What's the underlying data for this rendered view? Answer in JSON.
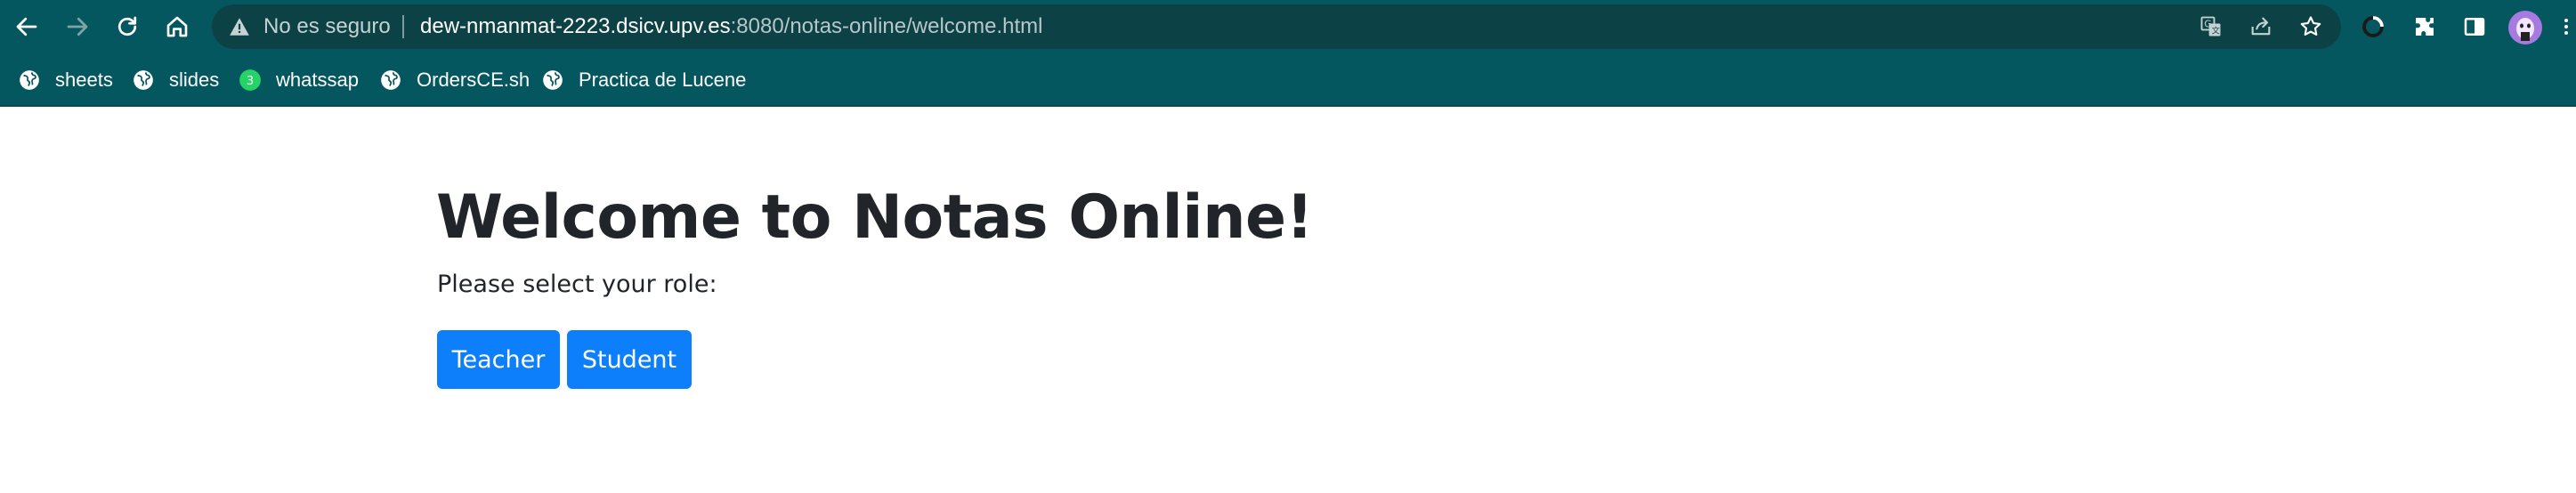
{
  "browser": {
    "security_status": "No es seguro",
    "url_host": "dew-nmanmat-2223.dsicv.upv.es",
    "url_rest": ":8080/notas-online/welcome.html",
    "bookmarks": [
      {
        "label": "sheets",
        "icon": "globe-icon"
      },
      {
        "label": "slides",
        "icon": "globe-icon"
      },
      {
        "label": "whatssap",
        "icon": "whatsapp-icon",
        "badge": "3"
      },
      {
        "label": "OrdersCE.sh",
        "icon": "globe-icon"
      },
      {
        "label": "Practica de Lucene",
        "icon": "globe-icon"
      }
    ],
    "colors": {
      "toolbar_bg": "#05575f",
      "omnibox_bg": "#0c4146",
      "avatar_bg": "#a77ae0"
    }
  },
  "page": {
    "title": "Welcome to Notas Online!",
    "prompt": "Please select your role:",
    "buttons": {
      "teacher": "Teacher",
      "student": "Student"
    },
    "colors": {
      "button_bg": "#0d7ffb",
      "text": "#212529"
    }
  }
}
